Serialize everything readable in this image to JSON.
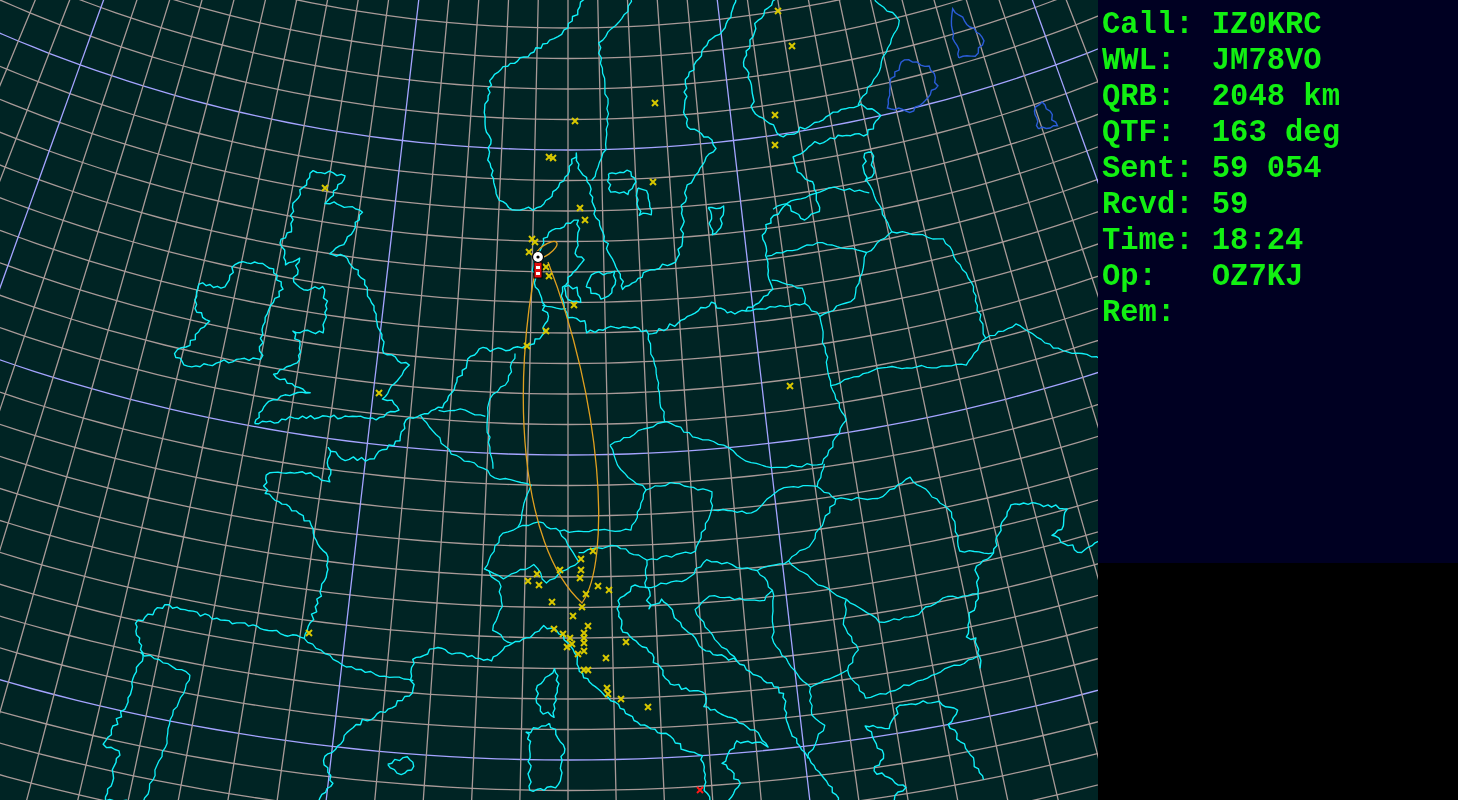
{
  "info_panel": {
    "fields": [
      {
        "label": "Call:",
        "value": "IZ0KRC"
      },
      {
        "label": "WWL:",
        "value": "JM78VO"
      },
      {
        "label": "QRB:",
        "value": "2048 km"
      },
      {
        "label": "QTF:",
        "value": "163 deg"
      },
      {
        "label": "Sent:",
        "value": "59 054"
      },
      {
        "label": "Rcvd:",
        "value": "59"
      },
      {
        "label": "Time:",
        "value": "18:24"
      },
      {
        "label": "Op:",
        "value": "OZ7KJ"
      },
      {
        "label": "Rem:"
      }
    ]
  }
}
